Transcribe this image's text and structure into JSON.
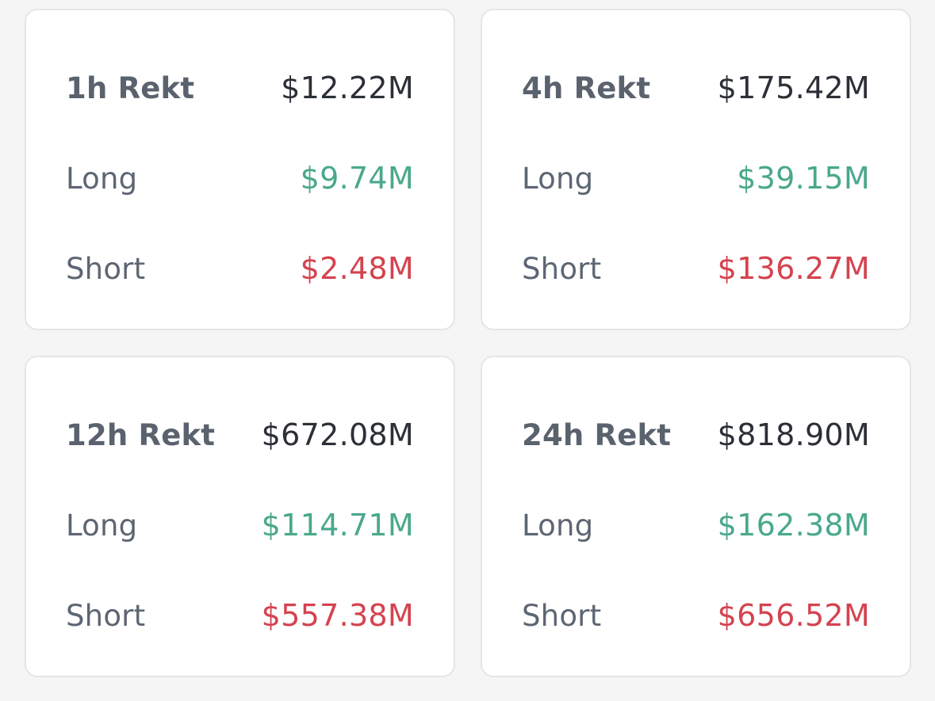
{
  "colors": {
    "background": "#f5f5f5",
    "card": "#ffffff",
    "card_border": "#e4e5e7",
    "label": "#5d6673",
    "total": "#2b2f36",
    "long": "#4aa88c",
    "short": "#d4434f"
  },
  "cards": [
    {
      "title": "1h Rekt",
      "total": "$12.22M",
      "long_label": "Long",
      "long": "$9.74M",
      "short_label": "Short",
      "short": "$2.48M"
    },
    {
      "title": "4h Rekt",
      "total": "$175.42M",
      "long_label": "Long",
      "long": "$39.15M",
      "short_label": "Short",
      "short": "$136.27M"
    },
    {
      "title": "12h Rekt",
      "total": "$672.08M",
      "long_label": "Long",
      "long": "$114.71M",
      "short_label": "Short",
      "short": "$557.38M"
    },
    {
      "title": "24h Rekt",
      "total": "$818.90M",
      "long_label": "Long",
      "long": "$162.38M",
      "short_label": "Short",
      "short": "$656.52M"
    }
  ]
}
